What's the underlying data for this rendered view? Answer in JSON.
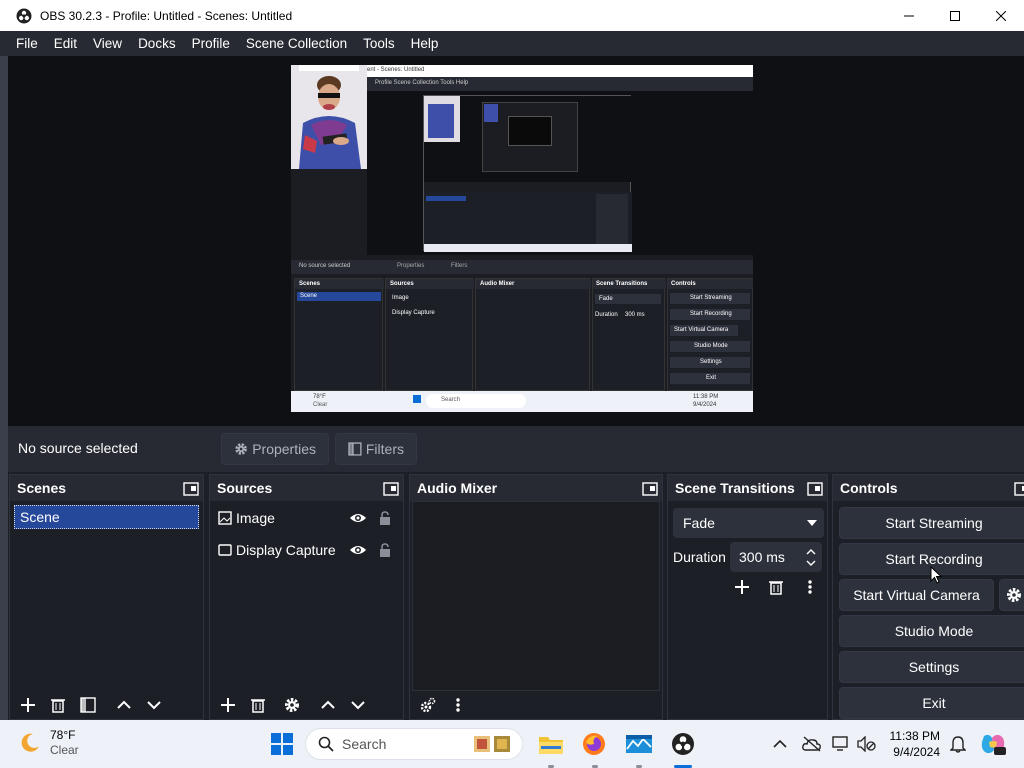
{
  "window": {
    "title": "OBS 30.2.3 - Profile: Untitled - Scenes: Untitled"
  },
  "menu": {
    "items": [
      "File",
      "Edit",
      "View",
      "Docks",
      "Profile",
      "Scene Collection",
      "Tools",
      "Help"
    ]
  },
  "source_bar": {
    "status": "No source selected",
    "properties_label": "Properties",
    "filters_label": "Filters"
  },
  "docks": {
    "scenes": {
      "title": "Scenes",
      "items": [
        "Scene"
      ]
    },
    "sources": {
      "title": "Sources",
      "items": [
        "Image",
        "Display Capture"
      ]
    },
    "audio": {
      "title": "Audio Mixer"
    },
    "transitions": {
      "title": "Scene Transitions",
      "selected": "Fade",
      "duration_label": "Duration",
      "duration_value": "300 ms"
    },
    "controls": {
      "title": "Controls",
      "start_streaming": "Start Streaming",
      "start_recording": "Start Recording",
      "start_virtual_camera": "Start Virtual Camera",
      "studio_mode": "Studio Mode",
      "settings": "Settings",
      "exit": "Exit"
    }
  },
  "preview_nested": {
    "menu": "ent - Scenes: Untitled",
    "menu2": "Profile   Scene Collection   Tools   Help",
    "no_source": "No source selected",
    "properties": "Properties",
    "filters": "Filters",
    "scenes": "Scenes",
    "sources": "Sources",
    "audio": "Audio Mixer",
    "transitions": "Scene Transitions",
    "controls": "Controls",
    "scene_item": "Scene",
    "src_image": "Image",
    "src_display": "Display Capture",
    "fade": "Fade",
    "duration": "Duration",
    "duration_val": "300 ms",
    "btn_stream": "Start Streaming",
    "btn_record": "Start Recording",
    "btn_vcam": "Start Virtual Camera",
    "btn_studio": "Studio Mode",
    "btn_settings": "Settings",
    "btn_exit": "Exit",
    "weather_temp": "78°F",
    "weather_cond": "Clear",
    "search": "Search",
    "clock_time": "11:38 PM",
    "clock_date": "9/4/2024"
  },
  "taskbar": {
    "weather_temp": "78°F",
    "weather_cond": "Clear",
    "search_placeholder": "Search",
    "time": "11:38 PM",
    "date": "9/4/2024"
  },
  "colors": {
    "accent": "#26489b",
    "panel": "#272a33",
    "background": "#1d1f26",
    "button": "#2d313c"
  }
}
